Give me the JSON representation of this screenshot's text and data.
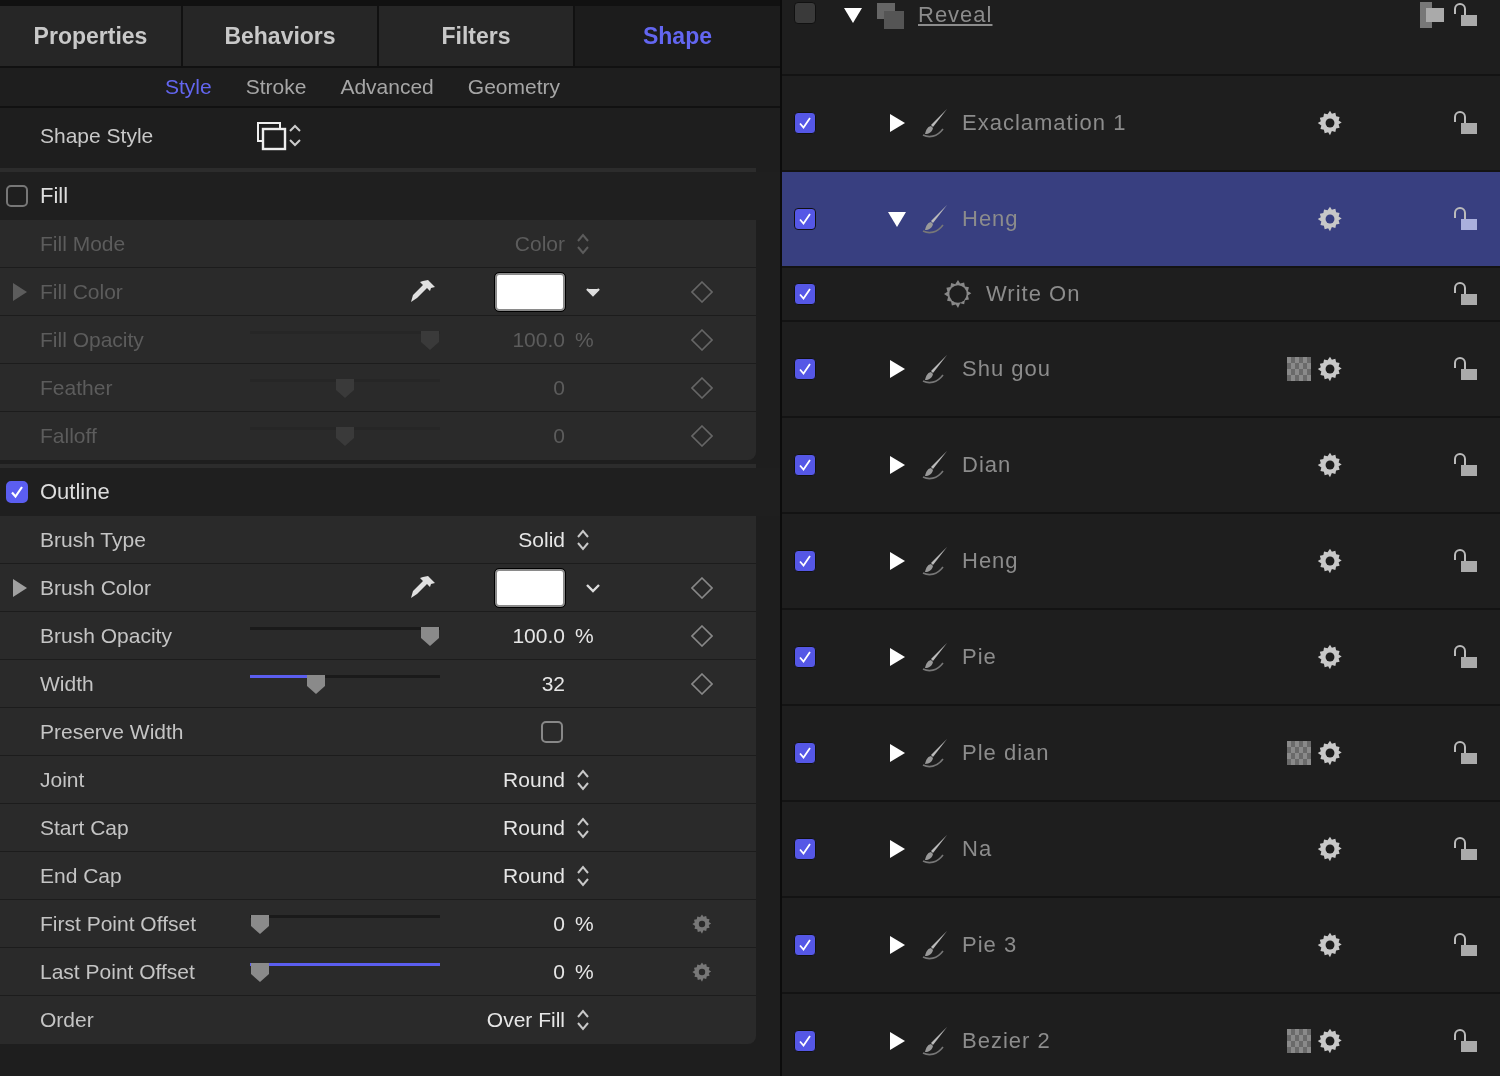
{
  "inspector": {
    "tabs": [
      {
        "label": "Properties",
        "selected": false
      },
      {
        "label": "Behaviors",
        "selected": false
      },
      {
        "label": "Filters",
        "selected": false
      },
      {
        "label": "Shape",
        "selected": true
      }
    ],
    "subtabs": [
      {
        "label": "Style",
        "selected": true
      },
      {
        "label": "Stroke",
        "selected": false
      },
      {
        "label": "Advanced",
        "selected": false
      },
      {
        "label": "Geometry",
        "selected": false
      }
    ],
    "shape_style": {
      "label": "Shape Style"
    },
    "sections": [
      {
        "title": "Fill",
        "checked": false,
        "rows": [
          {
            "kind": "popup",
            "label": "Fill Mode",
            "value": "Color"
          },
          {
            "kind": "color",
            "label": "Fill Color",
            "keyframe_button": true
          },
          {
            "kind": "slider",
            "label": "Fill Opacity",
            "level": 1,
            "value": "100.0",
            "unit": "%",
            "keyframe_button": true
          },
          {
            "kind": "slider",
            "label": "Feather",
            "level": 0.5,
            "value": "0",
            "keyframe_button": true
          },
          {
            "kind": "slider",
            "label": "Falloff",
            "level": 0.5,
            "value": "0",
            "keyframe_button": true
          }
        ]
      },
      {
        "title": "Outline",
        "checked": true,
        "rows": [
          {
            "kind": "popup",
            "label": "Brush Type",
            "value": "Solid"
          },
          {
            "kind": "color",
            "label": "Brush Color",
            "keyframe_button": true
          },
          {
            "kind": "slider",
            "label": "Brush Opacity",
            "level": 1,
            "value": "100.0",
            "unit": "%",
            "keyframe_button": true
          },
          {
            "kind": "slider",
            "label": "Width",
            "level": 0.33,
            "value": "32",
            "filled_left": true,
            "keyframe_button": true
          },
          {
            "kind": "checkbox",
            "label": "Preserve Width",
            "checked": false
          },
          {
            "kind": "popup",
            "label": "Joint",
            "value": "Round"
          },
          {
            "kind": "popup",
            "label": "Start Cap",
            "value": "Round"
          },
          {
            "kind": "popup",
            "label": "End Cap",
            "value": "Round"
          },
          {
            "kind": "slider",
            "label": "First Point Offset",
            "level": 0,
            "value": "0",
            "unit": "%",
            "gear_button": true
          },
          {
            "kind": "slider",
            "label": "Last Point Offset",
            "level": 0,
            "value": "0",
            "unit": "%",
            "filled_right": true,
            "gear_button": true
          },
          {
            "kind": "popup",
            "label": "Order",
            "value": "Over Fill"
          }
        ]
      }
    ]
  },
  "layers": [
    {
      "kind": "group",
      "name": "Reveal",
      "checked": false,
      "expanded": true,
      "selected": false,
      "children": [
        {
          "kind": "shape",
          "name": "Exaclamation 1",
          "checked": true,
          "expanded": false,
          "selected": false,
          "has_mask": false
        },
        {
          "kind": "shape",
          "name": "Heng",
          "checked": true,
          "expanded": true,
          "selected": true,
          "has_mask": false,
          "children": [
            {
              "kind": "behavior",
              "name": "Write On",
              "checked": true,
              "selected": false
            }
          ]
        },
        {
          "kind": "shape",
          "name": "Shu gou",
          "checked": true,
          "expanded": false,
          "selected": false,
          "has_mask": true
        },
        {
          "kind": "shape",
          "name": "Dian",
          "checked": true,
          "expanded": false,
          "selected": false,
          "has_mask": false
        },
        {
          "kind": "shape",
          "name": "Heng",
          "checked": true,
          "expanded": false,
          "selected": false,
          "has_mask": false
        },
        {
          "kind": "shape",
          "name": "Pie",
          "checked": true,
          "expanded": false,
          "selected": false,
          "has_mask": false
        },
        {
          "kind": "shape",
          "name": "Ple dian",
          "checked": true,
          "expanded": false,
          "selected": false,
          "has_mask": true
        },
        {
          "kind": "shape",
          "name": "Na",
          "checked": true,
          "expanded": false,
          "selected": false,
          "has_mask": false
        },
        {
          "kind": "shape",
          "name": "Pie 3",
          "checked": true,
          "expanded": false,
          "selected": false,
          "has_mask": false
        },
        {
          "kind": "shape",
          "name": "Bezier 2",
          "checked": true,
          "expanded": false,
          "selected": false,
          "has_mask": true
        }
      ]
    }
  ]
}
